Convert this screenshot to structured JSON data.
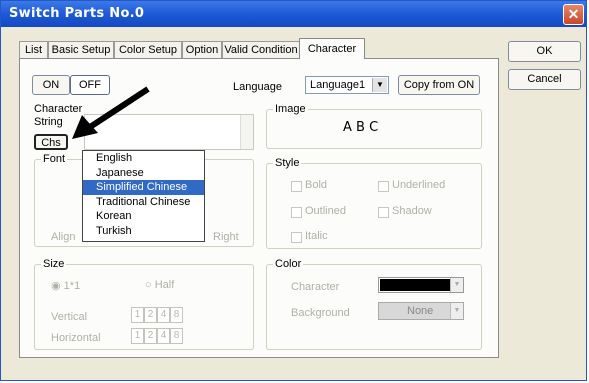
{
  "window": {
    "title": "Switch Parts No.0",
    "close_glyph": "✕"
  },
  "tabs": [
    {
      "label": "List"
    },
    {
      "label": "Basic Setup"
    },
    {
      "label": "Color Setup"
    },
    {
      "label": "Option"
    },
    {
      "label": "Valid Condition"
    },
    {
      "label": "Character"
    }
  ],
  "dialog_buttons": {
    "ok": "OK",
    "cancel": "Cancel"
  },
  "toggle": {
    "on": "ON",
    "off": "OFF"
  },
  "language": {
    "label": "Language",
    "value": "Language1",
    "copy_button": "Copy from ON"
  },
  "character_string": {
    "label_line1": "Character",
    "label_line2": "String",
    "chs_button": "Chs"
  },
  "font": {
    "label": "Font",
    "align_label": "Align",
    "right_label": "Right"
  },
  "font_dropdown_options": [
    "English",
    "Japanese",
    "Simplified Chinese",
    "Traditional Chinese",
    "Korean",
    "Turkish"
  ],
  "image": {
    "label": "Image",
    "preview_text": "A B C"
  },
  "style": {
    "label": "Style",
    "bold": "Bold",
    "underlined": "Underlined",
    "outlined": "Outlined",
    "shadow": "Shadow",
    "italic": "Italic"
  },
  "size": {
    "label": "Size",
    "opt1": "1*1",
    "opt2": "Half",
    "vertical": "Vertical",
    "horizontal": "Horizontal",
    "steps": [
      "1",
      "2",
      "4",
      "8"
    ]
  },
  "color": {
    "label": "Color",
    "character": "Character",
    "background": "Background",
    "background_value": "None",
    "character_color": "#000000"
  },
  "icons": {
    "annotation": "arrow-pointer-icon",
    "dropdown": "chevron-down-icon"
  }
}
